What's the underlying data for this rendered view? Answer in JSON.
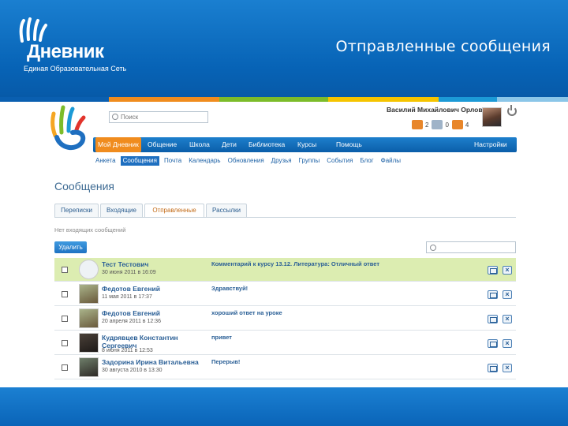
{
  "slide": {
    "logo_wordmark": "Дневник",
    "logo_tagline": "Единая Образовательная Сеть",
    "title": "Отправленные сообщения"
  },
  "colors": {
    "header_blue": "#0a6dc0",
    "accent_orange": "#f08c1e",
    "row_highlight": "#dcedb1",
    "strip": [
      "#0a5fb0",
      "#f08c1e",
      "#7cbc2a",
      "#f5c400",
      "#1c9ad6",
      "#8bc6e8"
    ]
  },
  "app": {
    "search_placeholder": "Поиск",
    "user_name": "Василий Михайлович Орлов",
    "counters": [
      {
        "icon": "messages-icon",
        "value": "2"
      },
      {
        "icon": "friends-icon",
        "value": "0"
      },
      {
        "icon": "notifications-icon",
        "value": "4"
      }
    ],
    "nav": [
      {
        "label": "Мой Дневник",
        "active": true
      },
      {
        "label": "Общение",
        "active": false
      },
      {
        "label": "Школа",
        "active": false
      },
      {
        "label": "Дети",
        "active": false
      },
      {
        "label": "Библиотека",
        "active": false
      },
      {
        "label": "Курсы",
        "active": false
      },
      {
        "label": "Помощь",
        "active": false
      },
      {
        "label": "Настройки",
        "active": false
      }
    ],
    "subnav": [
      {
        "label": "Анкета",
        "active": false
      },
      {
        "label": "Сообщения",
        "active": true
      },
      {
        "label": "Почта",
        "active": false
      },
      {
        "label": "Календарь",
        "active": false
      },
      {
        "label": "Обновления",
        "active": false
      },
      {
        "label": "Друзья",
        "active": false
      },
      {
        "label": "Группы",
        "active": false
      },
      {
        "label": "События",
        "active": false
      },
      {
        "label": "Блог",
        "active": false
      },
      {
        "label": "Файлы",
        "active": false
      }
    ],
    "heading": "Сообщения",
    "tabs": [
      {
        "label": "Переписки",
        "active": false
      },
      {
        "label": "Входящие",
        "active": false
      },
      {
        "label": "Отправленные",
        "active": true
      },
      {
        "label": "Рассылки",
        "active": false
      }
    ],
    "hint": "Нет входящих сообщений",
    "delete_label": "Удалить",
    "messages": [
      {
        "sender": "Тест Тестович",
        "date": "30 июня 2011 в 16:09",
        "subject": "Комментарий к курсу 13.12. Литература: Отличный ответ",
        "highlight": true,
        "avatar": "placeholder"
      },
      {
        "sender": "Федотов Евгений",
        "date": "11 мая 2011 в 17:37",
        "subject": "Здравствуй!",
        "highlight": false,
        "avatar": "photo"
      },
      {
        "sender": "Федотов Евгений",
        "date": "20 апреля 2011 в 12:36",
        "subject": "хороший ответ на уроке",
        "highlight": false,
        "avatar": "photo"
      },
      {
        "sender": "Кудрявцев Константин Сергеевич",
        "date": "8 июня 2011 в 12:53",
        "subject": "привет",
        "highlight": false,
        "avatar": "photo"
      },
      {
        "sender": "Задорина Ирина Витальевна",
        "date": "30 августа 2010 в 13:30",
        "subject": "Перерыв!",
        "highlight": false,
        "avatar": "photo"
      }
    ]
  }
}
